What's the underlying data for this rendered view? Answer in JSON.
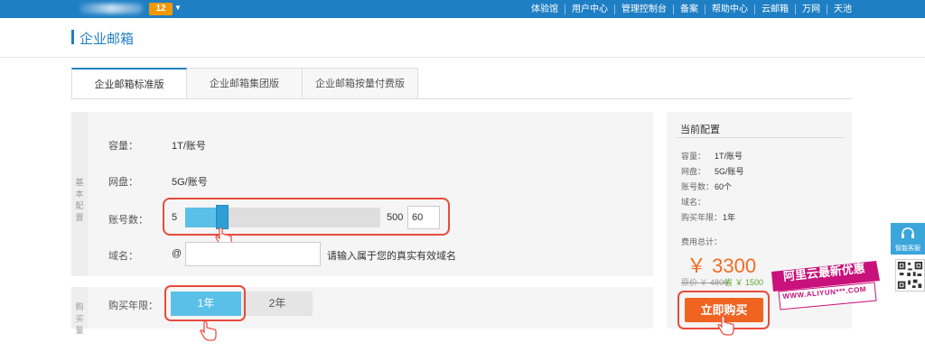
{
  "topbar": {
    "badge": "12",
    "nav": [
      "体验馆",
      "用户中心",
      "管理控制台",
      "备案",
      "帮助中心",
      "云邮箱",
      "万网",
      "天池"
    ]
  },
  "page": {
    "title": "企业邮箱"
  },
  "tabs": [
    "企业邮箱标准版",
    "企业邮箱集团版",
    "企业邮箱按量付费版"
  ],
  "config": {
    "section_basic": [
      "基",
      "本",
      "配",
      "置"
    ],
    "section_buy": [
      "购",
      "买",
      "量"
    ],
    "capacity": {
      "label": "容量：",
      "value": "1T/账号"
    },
    "disk": {
      "label": "网盘：",
      "value": "5G/账号"
    },
    "accounts": {
      "label": "账号数：",
      "min": "5",
      "max": "500",
      "value": "60",
      "fill_fraction": 0.11
    },
    "domain": {
      "label": "域名：",
      "at": "@",
      "value": "",
      "hint": "请输入属于您的真实有效域名"
    },
    "years": {
      "label": "购买年限：",
      "options": [
        "1年",
        "2年"
      ],
      "selected": "1年"
    }
  },
  "summary": {
    "title": "当前配置",
    "rows": [
      {
        "label": "容量：",
        "value": "1T/账号"
      },
      {
        "label": "网盘：",
        "value": "5G/账号"
      },
      {
        "label": "账号数：",
        "value": "60个"
      },
      {
        "label": "域名：",
        "value": ""
      },
      {
        "label": "购买年限：",
        "value": "1年"
      }
    ],
    "fee_label": "费用总计：",
    "price": "￥ 3300",
    "original": "原价 ￥ 4800",
    "save": "省 ￥ 1500",
    "buy_label": "立即购买"
  },
  "service": {
    "label": "智能客服"
  },
  "banner": {
    "line1": "阿里云最新优惠",
    "line2": "WWW.ALIYUN***.COM"
  },
  "colors": {
    "topbar": "#1f7fc4",
    "accent": "#5bc0e8",
    "buy": "#f06321",
    "highlight": "#e94b3c",
    "price": "#f36c21",
    "save": "#5aa832"
  }
}
